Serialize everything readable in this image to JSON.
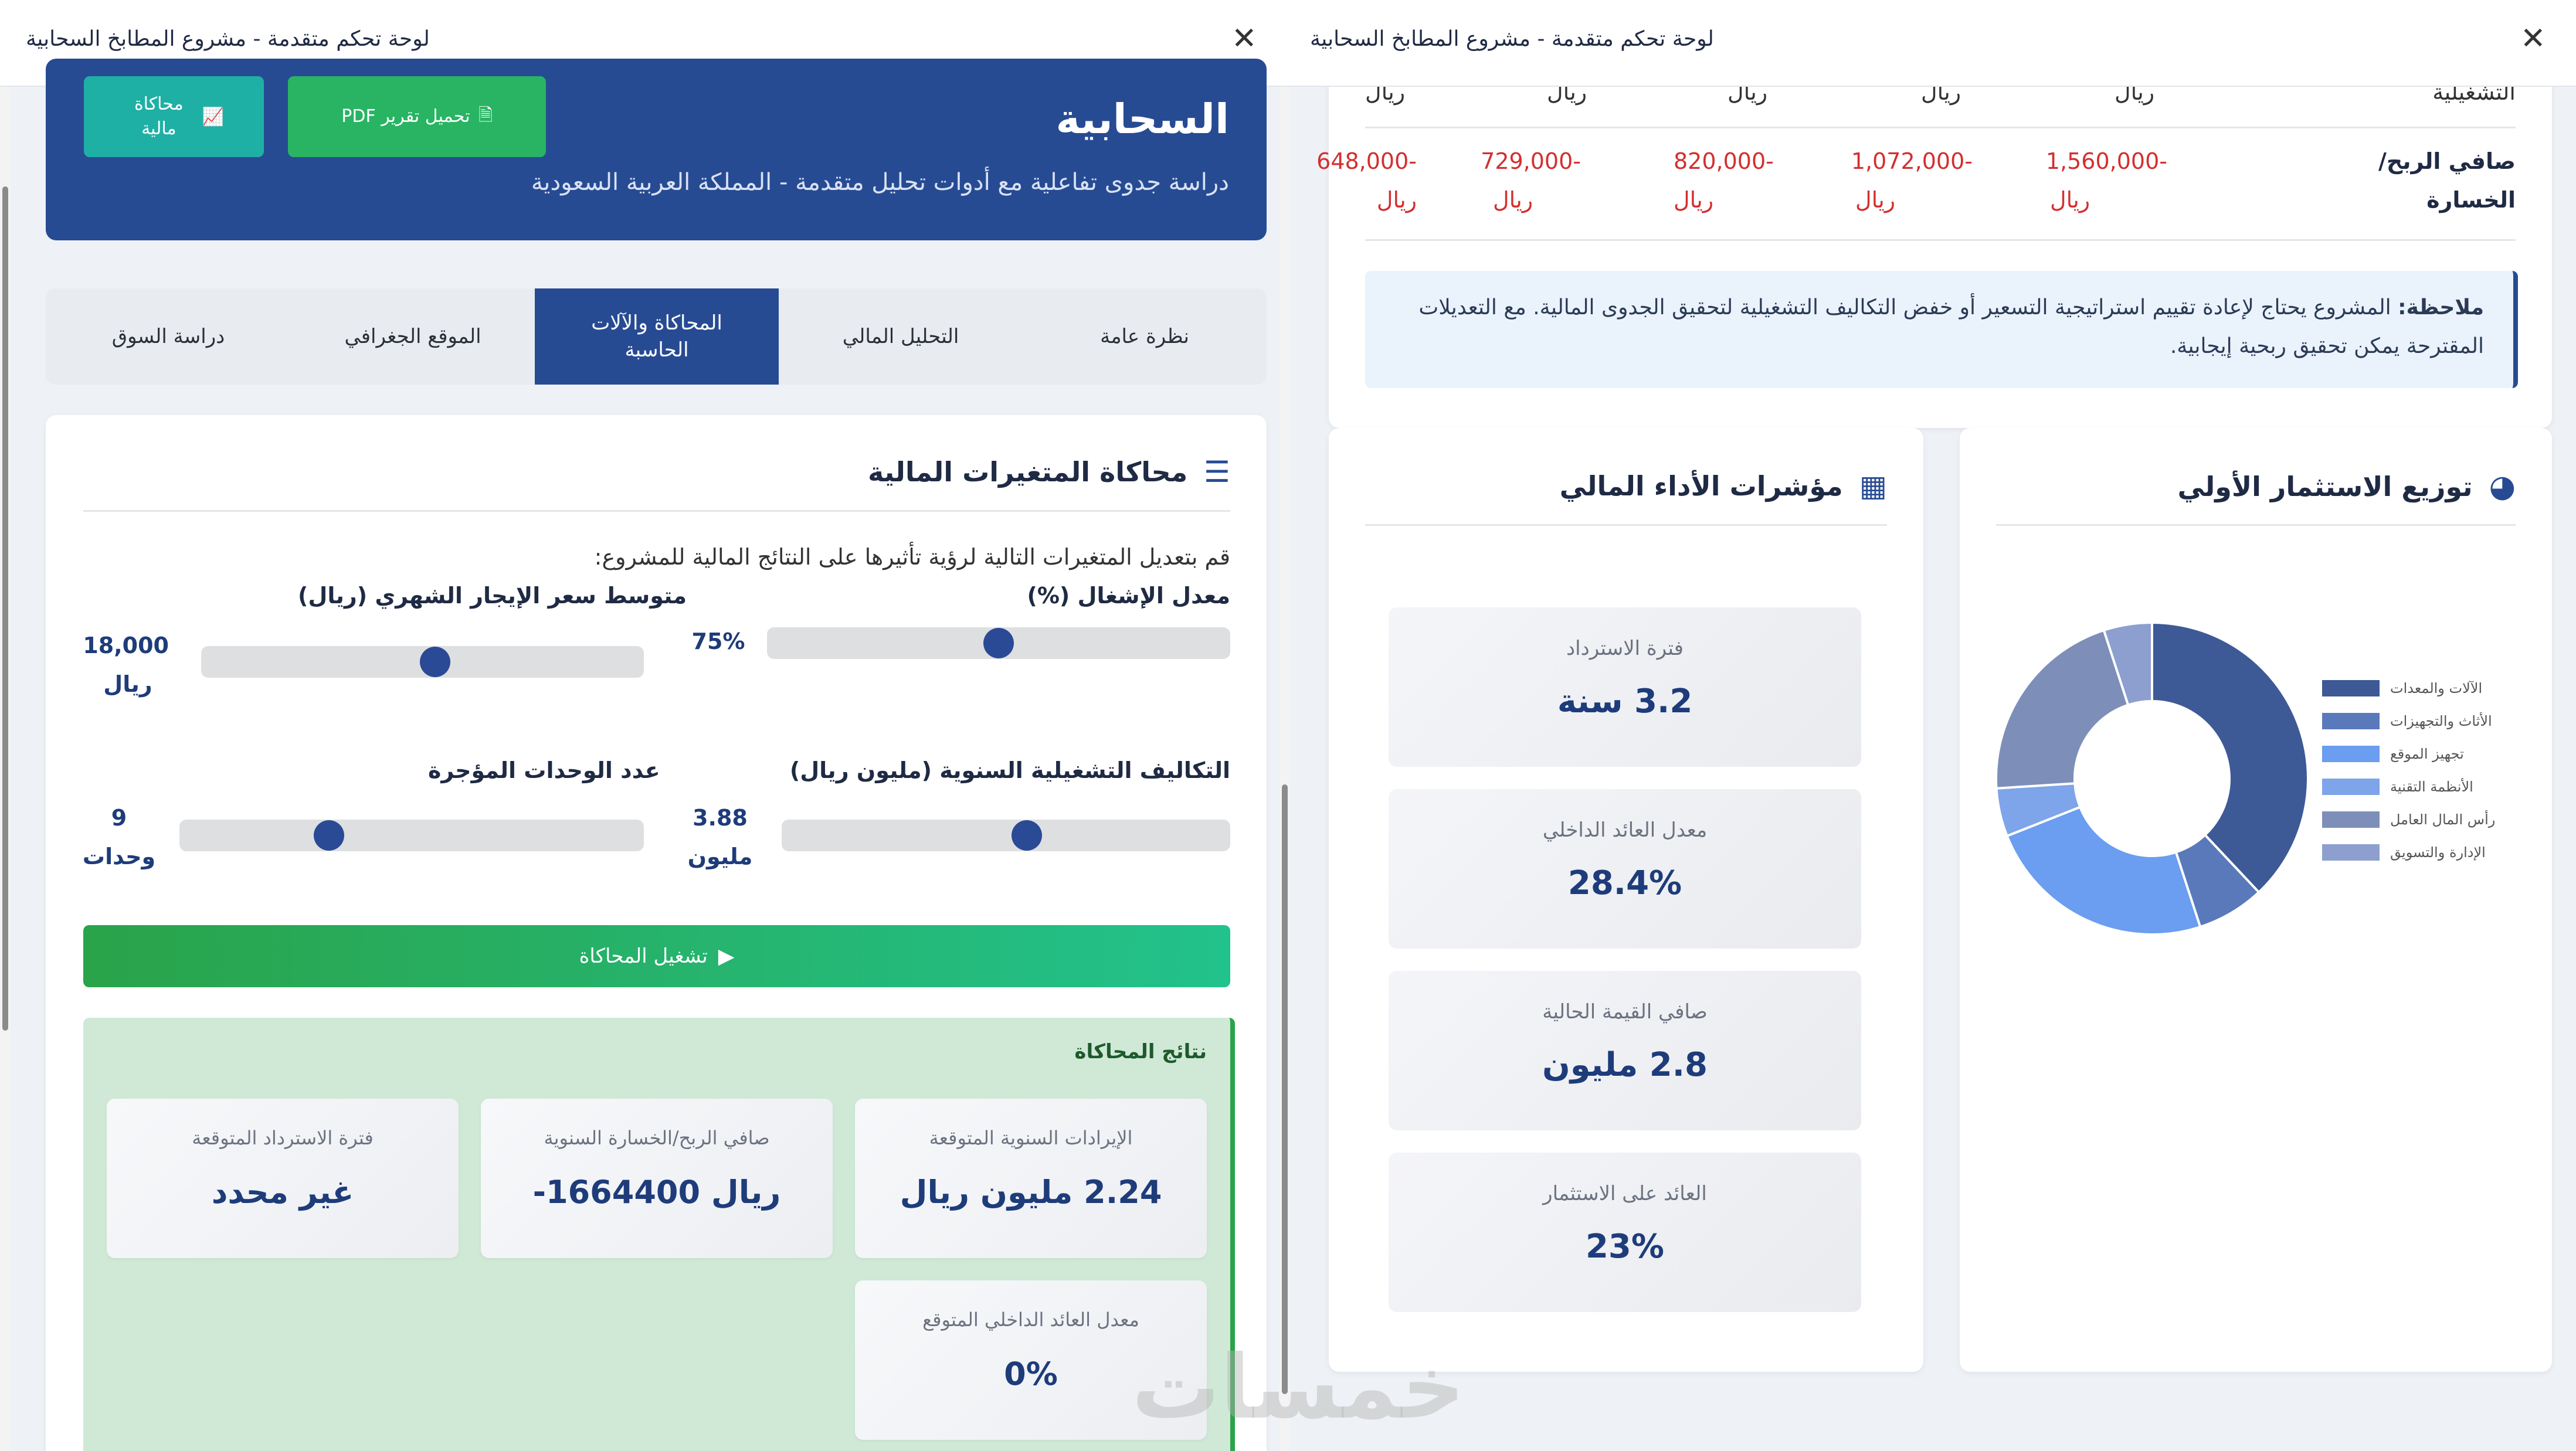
{
  "window_title": "لوحة تحكم متقدمة - مشروع المطابخ السحابية",
  "left": {
    "hero": {
      "title": "السحابية",
      "subtitle": "دراسة جدوى تفاعلية مع أدوات تحليل متقدمة - المملكة العربية السعودية",
      "btn_pdf": "تحميل تقرير PDF",
      "btn_sim": "محاكاة مالية"
    },
    "tabs": [
      "نظرة عامة",
      "التحليل المالي",
      "المحاكاة والآلات الحاسبة",
      "الموقع الجغرافي",
      "دراسة السوق"
    ],
    "section_title": "محاكاة المتغيرات المالية",
    "intro": "قم بتعديل المتغيرات التالية لرؤية تأثيرها على النتائج المالية للمشروع:",
    "sliders": [
      {
        "label": "معدل الإشغال (%)",
        "value": "75%",
        "fraction": 0.5
      },
      {
        "label": "متوسط سعر الإيجار الشهري (ريال)",
        "value": "18,000 ريال",
        "fraction": 0.53
      },
      {
        "label": "التكاليف التشغيلية السنوية (مليون ريال)",
        "value": "3.88 مليون",
        "fraction": 0.55
      },
      {
        "label": "عدد الوحدات المؤجرة",
        "value": "9 وحدات",
        "fraction": 0.31
      }
    ],
    "run_label": "تشغيل المحاكاة",
    "results": {
      "title": "نتائج المحاكاة",
      "boxes": [
        {
          "label": "الإيرادات السنوية المتوقعة",
          "value": "2.24 مليون ريال"
        },
        {
          "label": "صافي الربح/الخسارة السنوية",
          "value": "-1664400 ريال"
        },
        {
          "label": "فترة الاسترداد المتوقعة",
          "value": "غير محدد"
        },
        {
          "label": "معدل العائد الداخلي المتوقع",
          "value": "0%"
        }
      ]
    }
  },
  "right": {
    "table": {
      "row_prev_label": "التشغيلية",
      "row_prev_values": [
        "ريال",
        "ريال",
        "ريال",
        "ريال",
        "ريال"
      ],
      "row_label": "صافي الربح/ الخسارة",
      "values": [
        "-1,560,000 ريال",
        "-1,072,000 ريال",
        "-820,000 ريال",
        "-729,000 ريال",
        "-648,000 ريال"
      ]
    },
    "note": {
      "bold": "ملاحظة:",
      "text": "المشروع يحتاج لإعادة تقييم استراتيجية التسعير أو خفض التكاليف التشغيلية لتحقيق الجدوى المالية. مع التعديلات المقترحة يمكن تحقيق ربحية إيجابية."
    },
    "investment": {
      "title": "توزيع الاستثمار الأولي",
      "legend": [
        "الآلات والمعدات",
        "الأثاث والتجهيزات",
        "تجهيز الموقع",
        "الأنظمة التقنية",
        "رأس المال العامل",
        "الإدارة والتسويق"
      ],
      "colors": [
        "#3d5a96",
        "#5a79bb",
        "#6b9df0",
        "#7ea4ea",
        "#7d8fb8",
        "#8c9fcf"
      ]
    },
    "performance": {
      "title": "مؤشرات الأداء المالي",
      "metrics": [
        {
          "label": "فترة الاسترداد",
          "value": "3.2 سنة"
        },
        {
          "label": "معدل العائد الداخلي",
          "value": "28.4%"
        },
        {
          "label": "صافي القيمة الحالية",
          "value": "2.8 مليون"
        },
        {
          "label": "العائد على الاستثمار",
          "value": "23%"
        }
      ]
    }
  },
  "chart_data": {
    "type": "pie",
    "categories": [
      "الآلات والمعدات",
      "الأثاث والتجهيزات",
      "تجهيز الموقع",
      "الأنظمة التقنية",
      "رأس المال العامل",
      "الإدارة والتسويق"
    ],
    "values": [
      38,
      7,
      24,
      5,
      21,
      5
    ]
  },
  "watermark": "خمسات"
}
